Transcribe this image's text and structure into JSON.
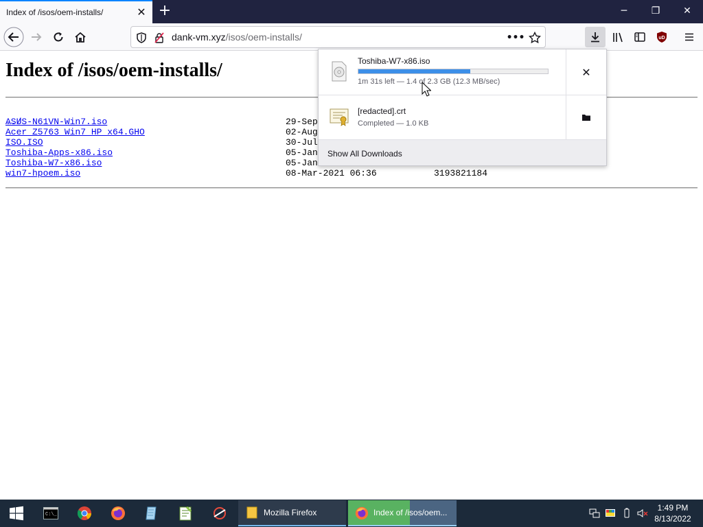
{
  "browser": {
    "tab_title": "Index of /isos/oem-installs/",
    "url_domain": "dank-vm.xyz",
    "url_path": "/isos/oem-installs/",
    "accent": "#0a84ff"
  },
  "page": {
    "heading": "Index of /isos/oem-installs/",
    "parent_link": "../",
    "entries": [
      {
        "name": "ASUS-N61VN-Win7.iso",
        "date": "29-Sep",
        "size": ""
      },
      {
        "name": "Acer_Z5763_Win7_HP_x64.GHO",
        "date": "02-Aug",
        "size": ""
      },
      {
        "name": "ISO.ISO",
        "date": "30-Jul",
        "size": ""
      },
      {
        "name": "Toshiba-Apps-x86.iso",
        "date": "05-Jan",
        "size": ""
      },
      {
        "name": "Toshiba-W7-x86.iso",
        "date": "05-Jan",
        "size": ""
      },
      {
        "name": "win7-hpoem.iso",
        "date": "08-Mar-2021 06:36",
        "size": "3193821184"
      }
    ]
  },
  "downloads": {
    "items": [
      {
        "name": "Toshiba-W7-x86.iso",
        "status": "1m 31s left — 1.4 of 2.3 GB (12.3 MB/sec)",
        "progress": 0.59,
        "action": "cancel"
      },
      {
        "name": "[redacted].crt",
        "status": "Completed — 1.0 KB",
        "action": "open-folder"
      }
    ],
    "show_all_label": "Show All Downloads"
  },
  "taskbar": {
    "tasks": [
      {
        "label": "Mozilla Firefox",
        "active": false
      },
      {
        "label": "Index of /isos/oem...",
        "active": true
      }
    ],
    "time": "1:49 PM",
    "date": "8/13/2022"
  }
}
